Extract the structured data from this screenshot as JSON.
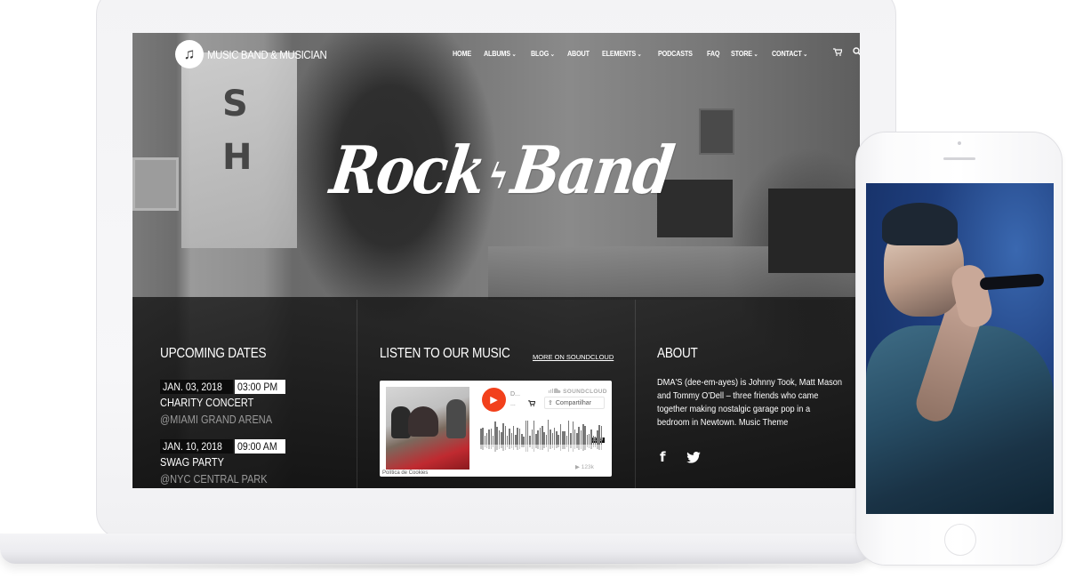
{
  "site": {
    "logo_icon": "music-note-icon",
    "logo_glyph": "♫",
    "name": "MUSIC BAND & MUSICIAN"
  },
  "nav": {
    "items": [
      {
        "label": "HOME",
        "dropdown": false
      },
      {
        "label": "ALBUMS",
        "dropdown": true
      },
      {
        "label": "BLOG",
        "dropdown": true
      },
      {
        "label": "ABOUT",
        "dropdown": false
      },
      {
        "label": "ELEMENTS",
        "dropdown": true
      },
      {
        "label": "PODCASTS",
        "dropdown": false
      },
      {
        "label": "FAQ",
        "dropdown": false
      },
      {
        "label": "STORE",
        "dropdown": true
      },
      {
        "label": "CONTACT",
        "dropdown": true
      }
    ],
    "chevron_glyph": "⌄",
    "cart_icon": "cart-icon",
    "cart_glyph": "🛒",
    "search_icon": "search-icon",
    "search_glyph": "⚲"
  },
  "hero": {
    "title_left": "Rock",
    "bolt_glyph": "ϟ",
    "title_right": "Band",
    "sign_letters": "S\nH",
    "sign_letters_list": [
      "S",
      "H"
    ]
  },
  "upcoming": {
    "title": "UPCOMING DATES",
    "events": [
      {
        "date": "JAN. 03, 2018",
        "time": "03:00 PM",
        "name": "CHARITY CONCERT",
        "venue": "@MIAMI GRAND ARENA"
      },
      {
        "date": "JAN. 10, 2018",
        "time": "09:00 AM",
        "name": "SWAG PARTY",
        "venue": "@NYC CENTRAL PARK"
      }
    ]
  },
  "music": {
    "title": "LISTEN TO OUR MUSIC",
    "more_link": "MORE ON SOUNDCLOUD",
    "widget": {
      "brand": "SOUNDCLOUD",
      "play_glyph": "▶",
      "meta_line1": "D...",
      "meta_line2": "...",
      "share_label": "Compartilhar",
      "share_glyph": "⇪",
      "cart_glyph": "🛒",
      "duration": "3:29",
      "plays": "▶ 123k",
      "cookie_label": "Política de Cookies",
      "progress": 0.0
    }
  },
  "about": {
    "title": "ABOUT",
    "text": "DMA'S (dee-em-ayes) is Johnny Took, Matt Mason and Tommy O'Dell – three friends who came together making nostalgic garage pop in a bedroom in Newtown. Music Theme",
    "social": [
      {
        "name": "facebook",
        "glyph": "f"
      },
      {
        "name": "twitter",
        "glyph": "🐦"
      }
    ]
  },
  "colors": {
    "accent_play": "#f2401b",
    "footer_bg": "#141414",
    "phone_screen": "#1f3f7e"
  }
}
